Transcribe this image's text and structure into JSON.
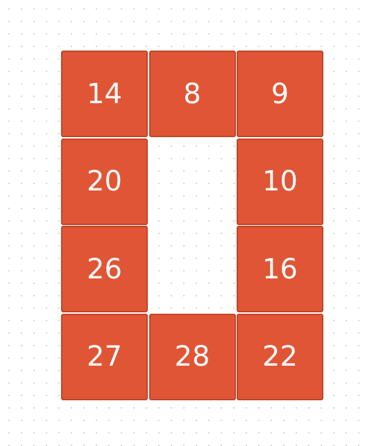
{
  "colors": {
    "tile_fill": "#e05535",
    "tile_border": "#c1442a",
    "tile_text": "#ffffff",
    "background": "#ffffff",
    "grid_dots": "#d3d6dc"
  },
  "board": {
    "columns": 3,
    "rows": 4,
    "tiles": [
      {
        "value": "14",
        "row": 1,
        "col": 1
      },
      {
        "value": "8",
        "row": 1,
        "col": 2
      },
      {
        "value": "9",
        "row": 1,
        "col": 3
      },
      {
        "value": "20",
        "row": 2,
        "col": 1
      },
      {
        "value": "10",
        "row": 2,
        "col": 3
      },
      {
        "value": "26",
        "row": 3,
        "col": 1
      },
      {
        "value": "16",
        "row": 3,
        "col": 3
      },
      {
        "value": "27",
        "row": 4,
        "col": 1
      },
      {
        "value": "28",
        "row": 4,
        "col": 2
      },
      {
        "value": "22",
        "row": 4,
        "col": 3
      }
    ],
    "empty_cells": [
      {
        "row": 2,
        "col": 2
      },
      {
        "row": 3,
        "col": 2
      }
    ]
  }
}
